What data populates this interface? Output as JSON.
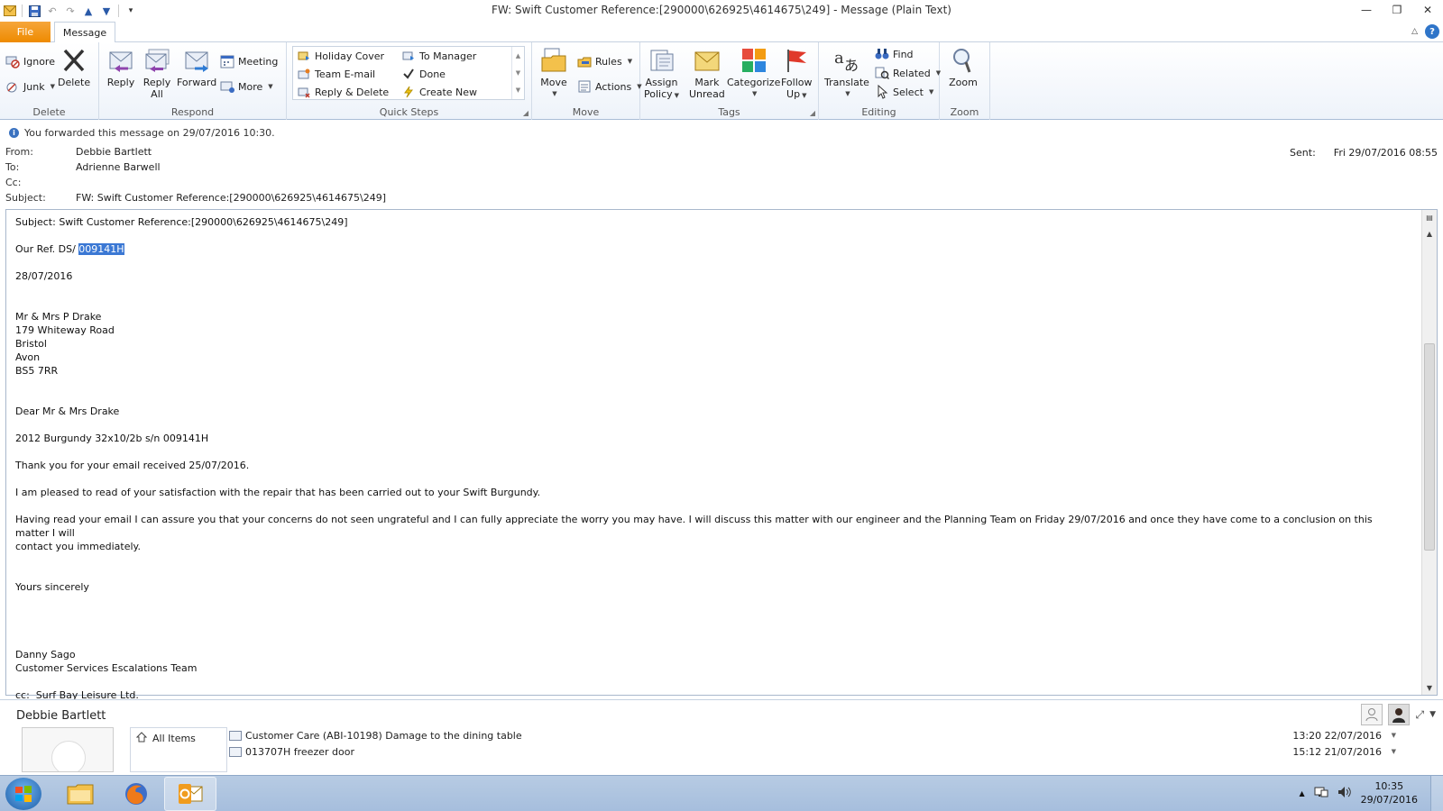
{
  "window": {
    "title": "FW: Swift Customer Reference:[290000\\626925\\4614675\\249]  -  Message (Plain Text)"
  },
  "tabs": {
    "file": "File",
    "message": "Message"
  },
  "ribbon": {
    "delete": {
      "label": "Delete",
      "ignore": "Ignore",
      "junk": "Junk",
      "delete": "Delete"
    },
    "respond": {
      "label": "Respond",
      "reply": "Reply",
      "reply_all_1": "Reply",
      "reply_all_2": "All",
      "forward": "Forward",
      "meeting": "Meeting",
      "more": "More"
    },
    "quick_steps": {
      "label": "Quick Steps",
      "items": [
        "Holiday Cover",
        "Team E-mail",
        "Reply & Delete",
        "To Manager",
        "Done",
        "Create New"
      ]
    },
    "move": {
      "label": "Move",
      "move": "Move",
      "rules": "Rules",
      "actions": "Actions"
    },
    "tags": {
      "label": "Tags",
      "assign_1": "Assign",
      "assign_2": "Policy",
      "mark_1": "Mark",
      "mark_2": "Unread",
      "categorize": "Categorize",
      "follow_1": "Follow",
      "follow_2": "Up"
    },
    "editing": {
      "label": "Editing",
      "translate": "Translate",
      "find": "Find",
      "related": "Related",
      "select": "Select"
    },
    "zoom": {
      "label": "Zoom",
      "zoom": "Zoom"
    }
  },
  "header": {
    "info": "You forwarded this message on 29/07/2016 10:30.",
    "from_label": "From:",
    "from": "Debbie Bartlett",
    "to_label": "To:",
    "to": "Adrienne Barwell",
    "cc_label": "Cc:",
    "cc": "",
    "subject_label": "Subject:",
    "subject": "FW: Swift Customer Reference:[290000\\626925\\4614675\\249]",
    "sent_label": "Sent:",
    "sent": "Fri 29/07/2016 08:55"
  },
  "body": {
    "subject_line": "Subject: Swift Customer Reference:[290000\\626925\\4614675\\249]",
    "ref_prefix": "Our Ref. DS/ ",
    "ref_selected": "009141H",
    "date": "28/07/2016",
    "address": [
      "Mr & Mrs P Drake",
      "179 Whiteway Road",
      "Bristol",
      "Avon",
      "BS5 7RR"
    ],
    "salutation": "Dear Mr & Mrs Drake",
    "product": "2012 Burgundy 32x10/2b s/n 009141H",
    "p1": "Thank you for your email received 25/07/2016.",
    "p2": "I am pleased to read of your satisfaction with the repair that has been carried out to your Swift Burgundy.",
    "p3a": "Having read your email I can assure you that your concerns do not seen ungrateful and I can fully appreciate the worry you may have. I will discuss this matter with our engineer and the Planning Team on Friday 29/07/2016 and once they have come to a conclusion on this matter I will",
    "p3b": "contact you immediately.",
    "closing": "Yours sincerely",
    "sig_name": "Danny Sago",
    "sig_team": "Customer Services Escalations Team",
    "cc_line": "cc:  Surf Bay Leisure Ltd."
  },
  "people": {
    "name": "Debbie Bartlett",
    "all_items": "All Items",
    "items": [
      {
        "subject": "Customer Care (ABI-10198) Damage to the dining table",
        "date": "13:20  22/07/2016"
      },
      {
        "subject": "013707H freezer door",
        "date": "15:12  21/07/2016"
      }
    ]
  },
  "taskbar": {
    "time": "10:35",
    "date": "29/07/2016"
  },
  "colors": {
    "file_tab": "#ee8a00",
    "selection": "#3b78d4",
    "ribbon_border": "#aabdd6"
  }
}
